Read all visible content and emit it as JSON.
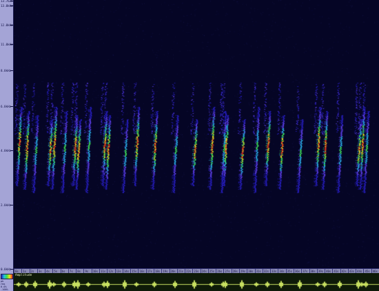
{
  "freq_axis": {
    "labels": [
      {
        "text": "13.762k",
        "value": 13.762
      },
      {
        "text": "13.0kHz",
        "value": 13.0
      },
      {
        "text": "12.0kHz",
        "value": 12.0
      },
      {
        "text": "11.0kHz",
        "value": 11.0
      },
      {
        "text": "8.0kHz",
        "value": 8.0
      },
      {
        "text": "6.0kHz",
        "value": 6.0
      },
      {
        "text": "4.0kHz",
        "value": 4.0
      },
      {
        "text": "2.0kHz",
        "value": 2.0
      },
      {
        "text": "0.0kHz",
        "value": 0.0
      }
    ]
  },
  "time_ruler": {
    "labels": [
      "0s",
      "1s",
      "2s",
      "3s",
      "4s",
      "5s",
      "6s",
      "7s",
      "8s",
      "9s",
      "10s",
      "11s",
      "12s",
      "13s",
      "14s",
      "15s",
      "16s",
      "17s",
      "18s",
      "19s",
      "20s",
      "21s",
      "22s",
      "23s",
      "24s",
      "25s",
      "26s",
      "27s",
      "28s",
      "29s",
      "30s",
      "31s",
      "32s",
      "33s",
      "34s",
      "35s",
      "36s",
      "37s",
      "38s",
      "39s",
      "40s",
      "41s",
      "42s",
      "43s",
      "44s",
      "45s",
      "46s"
    ]
  },
  "amplitude_panel": {
    "title": "Amplitude",
    "labels": [
      "pk",
      "rms",
      "0.0%",
      "-100%"
    ]
  },
  "colors": {
    "background": "#050525",
    "axis": "#a4a4d6",
    "waveform_bg": "#0e1a08",
    "waveform_line": "#c8e060"
  }
}
